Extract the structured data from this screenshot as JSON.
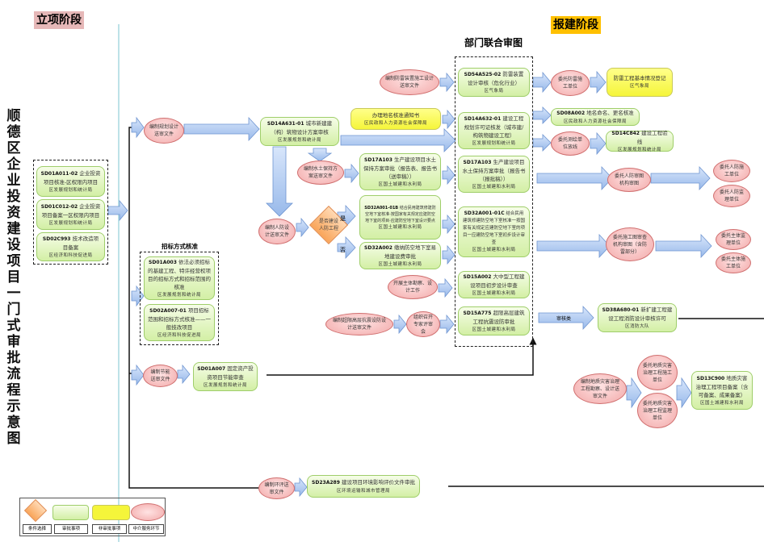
{
  "title": "顺德区企业投资建设项目一门式审批流程示意图",
  "stages": {
    "project": "立项阶段",
    "construction": "报建阶段",
    "joint_review": "部门联合审图",
    "bidding": "招标方式核准"
  },
  "colors": {
    "stage_project_bg": "#e6b8b8",
    "stage_construction_bg": "#ffc000",
    "approval": "#d3efa5",
    "non_approval": "#f5f53a",
    "agency": "#f2a9a9",
    "condition": "#f9a55a",
    "arrow": "#a9c6f0"
  },
  "project_stage": [
    {
      "code": "SD01A011-02",
      "text": "企业投资项目核准-区权限内项目",
      "dept": "区发展规划和统计局"
    },
    {
      "code": "SD01C012-02",
      "text": "企业投资项目备案一区权限内项目",
      "dept": "区发展规划和统计局"
    },
    {
      "code": "SD02C993",
      "text": "技术改造项目备案",
      "dept": "区经济和科技促进局"
    }
  ],
  "bidding": [
    {
      "code": "SD01A003",
      "text": "依法必须招标的基建工程、特许经营权项目的招标方式和招标范围的核准",
      "dept": "区发展规划和统计局"
    },
    {
      "code": "SD02A007-01",
      "text": "项目招标范围和招标方式核准——一般技改项目",
      "dept": "区经济和科技促进局"
    }
  ],
  "ovals": {
    "planning_design": "编制规划设计送审文件",
    "soil_water": "编制水土保持方案送审文件",
    "civil_defense": "编制人防设计送审文件",
    "energy": "编制节能送审文件",
    "lightning_design": "编制防雷装置施工设计送审文件",
    "survey": "开展主体勘察、设计工作",
    "seismic": "编制超限高层抗震设防设计送审文件",
    "expert": "组织召开专家评审会",
    "env": "编制环评送审文件",
    "lightning_unit": "委托防雷施工单位",
    "mapping": "委托测绘单位放线",
    "civil_review": "委托人防审图机构审图",
    "civil_build": "委托人防施工单位",
    "civil_supervise": "委托人防监理单位",
    "drawing_review": "委托施工图审查机构审图（含防雷部分）",
    "main_supervise": "委托主体监理单位",
    "main_build": "委托主体施工单位",
    "geo_survey": "编制地质灾害治理工程勘察、设计送审文件",
    "geo_build": "委托地质灾害治理工程施工单位",
    "geo_supervise": "委托地质灾害治理工程监理单位"
  },
  "boxes": {
    "sd14a631": {
      "code": "SD14A631-01",
      "text": "城市新建建（构）筑物设计方案审核",
      "dept": "区发展规划和统计局"
    },
    "place_name_notice": {
      "text": "办理地名核准通知书",
      "dept": "区民政和人力资源社会保障局"
    },
    "sd17a103_left": {
      "code": "SD17A103",
      "text": "生产建设项目水土保持方案审批（报告表、报告书（送审稿））",
      "dept": "区国土城建和水利局"
    },
    "sd32a001_01b": {
      "code": "SD32A001-01B",
      "text": "结合民用建筑修建防空地下室核准-按国家有关规定应建防空地下室的项目-应建防空地下室设计要点",
      "dept": "区国土城建和水利局"
    },
    "sd32a002": {
      "code": "SD32A002",
      "text": "缴纳防空地下室易地建设费审批",
      "dept": "区国土城建和水利局"
    },
    "sd01a007": {
      "code": "SD01A007",
      "text": "固定资产投资项目节能审查",
      "dept": "区发展规划和统计局"
    },
    "sd23a289": {
      "code": "SD23A289",
      "text": "建设项目环境影响评价文件审批",
      "dept": "区环境运输和城市管理局"
    },
    "sd54a525": {
      "code": "SD54A525-02",
      "text": "防雷装置设计审核（危化行业）",
      "dept": "区气象局"
    },
    "sd14a632": {
      "code": "SD14A632-01",
      "text": "建设工程规划许可证核发（城市建/构筑物建设工程）",
      "dept": "区发展规划和统计局"
    },
    "sd17a103_right": {
      "code": "SD17A103",
      "text": "生产建设项目水土保持方案审批（报告书（报批稿））",
      "dept": "区国土城建和水利局"
    },
    "sd32a001_01c": {
      "code": "SD32A001-01C",
      "text": "结合民用建筑修建防空地下室核准一按国家有关规定应建防空地下室的项目一应建防空地下室初步设计审查",
      "dept": "区国土城建和水利局"
    },
    "sd15a002": {
      "code": "SD15A002",
      "text": "大中型工程建设项目初步设计审查",
      "dept": "区国土城建和水利局"
    },
    "sd15a775": {
      "code": "SD15A775",
      "text": "超限高层建筑工程抗震设防审批",
      "dept": "区国土城建和水利局"
    },
    "lightning_register": {
      "text": "防雷工程基本情况登记",
      "dept": "区气象局"
    },
    "sd08a002": {
      "code": "SD08A002",
      "text": "地名命名、更名核准",
      "dept": "区民政和人力资源社会保障局"
    },
    "sd14c842": {
      "code": "SD14C842",
      "text": "建设工程验线",
      "dept": "区发展规划和统计局"
    },
    "sd38a680": {
      "code": "SD38A680-01",
      "text": "新扩建工程建设工程消防设计审核许可",
      "dept": "区消防大队"
    },
    "sd13c900": {
      "code": "SD13C900",
      "text": "地质灾害治理工程项目备案（含可备案、成果备案）",
      "dept": "区国土城建和水利局"
    }
  },
  "decision": {
    "question": "是否建设人防工程",
    "yes": "是",
    "no": "否"
  },
  "review_arrow_label": "审核类",
  "legend": [
    {
      "shape": "diamond",
      "label": "条件选择"
    },
    {
      "shape": "green",
      "label": "审批事项"
    },
    {
      "shape": "yellow",
      "label": "非审批事项"
    },
    {
      "shape": "oval",
      "label": "中介服务环节"
    }
  ]
}
